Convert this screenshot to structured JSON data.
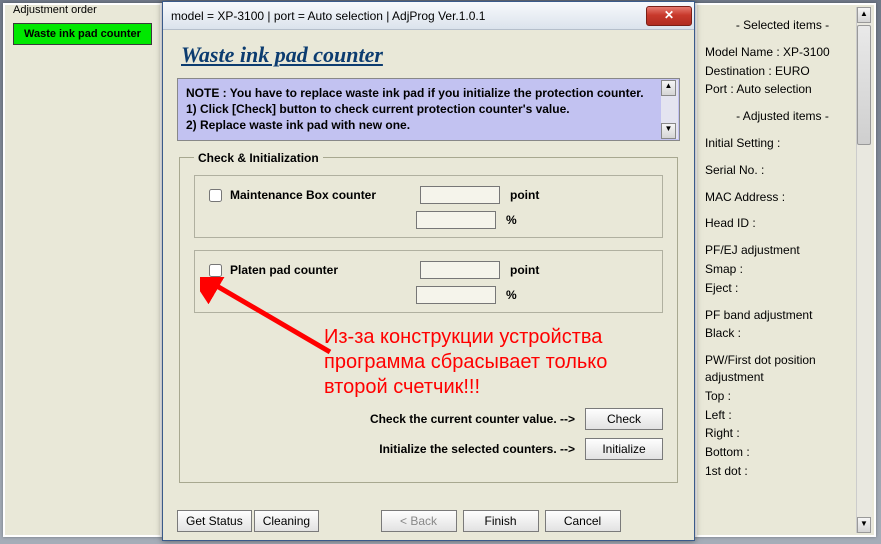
{
  "left": {
    "title": "Adjustment order",
    "button": "Waste ink pad counter"
  },
  "dialog": {
    "title": "model = XP-3100 | port = Auto selection | AdjProg Ver.1.0.1",
    "close": "✕",
    "heading": "Waste ink pad counter",
    "note_l1": "NOTE : You have to replace waste ink pad if you initialize the protection counter.",
    "note_l2": "1) Click [Check] button to check current protection counter's value.",
    "note_l3": "2) Replace waste ink pad with new one.",
    "group_legend": "Check & Initialization",
    "counter1_label": "Maintenance Box counter",
    "counter2_label": "Platen pad counter",
    "unit_point": "point",
    "unit_percent": "%",
    "annotation_l1": "Из-за конструкции устройства",
    "annotation_l2": "программа сбрасывает только",
    "annotation_l3": "второй счетчик!!!",
    "check_text": "Check the current counter value. -->",
    "init_text": "Initialize the selected counters. -->",
    "btn_check": "Check",
    "btn_init": "Initialize",
    "btn_getstatus": "Get Status",
    "btn_cleaning": "Cleaning",
    "btn_back": "< Back",
    "btn_finish": "Finish",
    "btn_cancel": "Cancel"
  },
  "right": {
    "selected_header": "- Selected items -",
    "model": "Model Name : XP-3100",
    "dest": "Destination : EURO",
    "port": "Port : Auto selection",
    "adjusted_header": "- Adjusted items -",
    "init": "Initial Setting :",
    "serial": "Serial No. :",
    "mac": "MAC Address :",
    "head": "Head ID :",
    "pfej": "PF/EJ adjustment",
    "smap": " Smap :",
    "eject": " Eject :",
    "pfband": "PF band adjustment",
    "black": " Black :",
    "pwfirst": "PW/First dot position adjustment",
    "top": " Top :",
    "leftv": " Left :",
    "rightv": " Right :",
    "bottom": " Bottom :",
    "firstdot": " 1st dot :"
  }
}
